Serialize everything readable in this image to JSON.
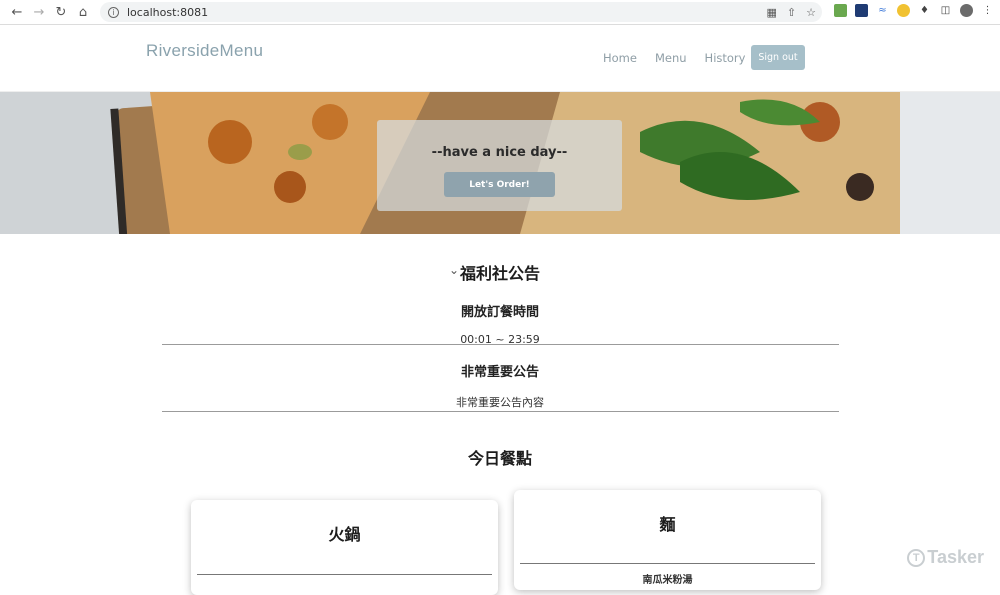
{
  "browser": {
    "url": "localhost:8081",
    "back_icon": "arrow-left-icon",
    "forward_icon": "arrow-right-icon",
    "reload_icon": "reload-icon",
    "home_icon": "home-icon"
  },
  "site": {
    "brand": "RiversideMenu",
    "nav": [
      "Home",
      "Menu",
      "History"
    ],
    "signout_label": "Sign out",
    "accent": "#a6bfc9"
  },
  "hero": {
    "tagline": "--have a nice day--",
    "cta_label": "Let's Order!"
  },
  "announcements": {
    "title": "福利社公告",
    "items": [
      {
        "heading": "開放訂餐時間",
        "body": "00:01 ~ 23:59"
      },
      {
        "heading": "非常重要公告",
        "body": "非常重要公告內容"
      }
    ]
  },
  "today": {
    "title": "今日餐點",
    "cards": [
      {
        "name": "火鍋",
        "sub": ""
      },
      {
        "name": "麵",
        "sub": "南瓜米粉湯"
      }
    ]
  },
  "watermark": "Tasker"
}
